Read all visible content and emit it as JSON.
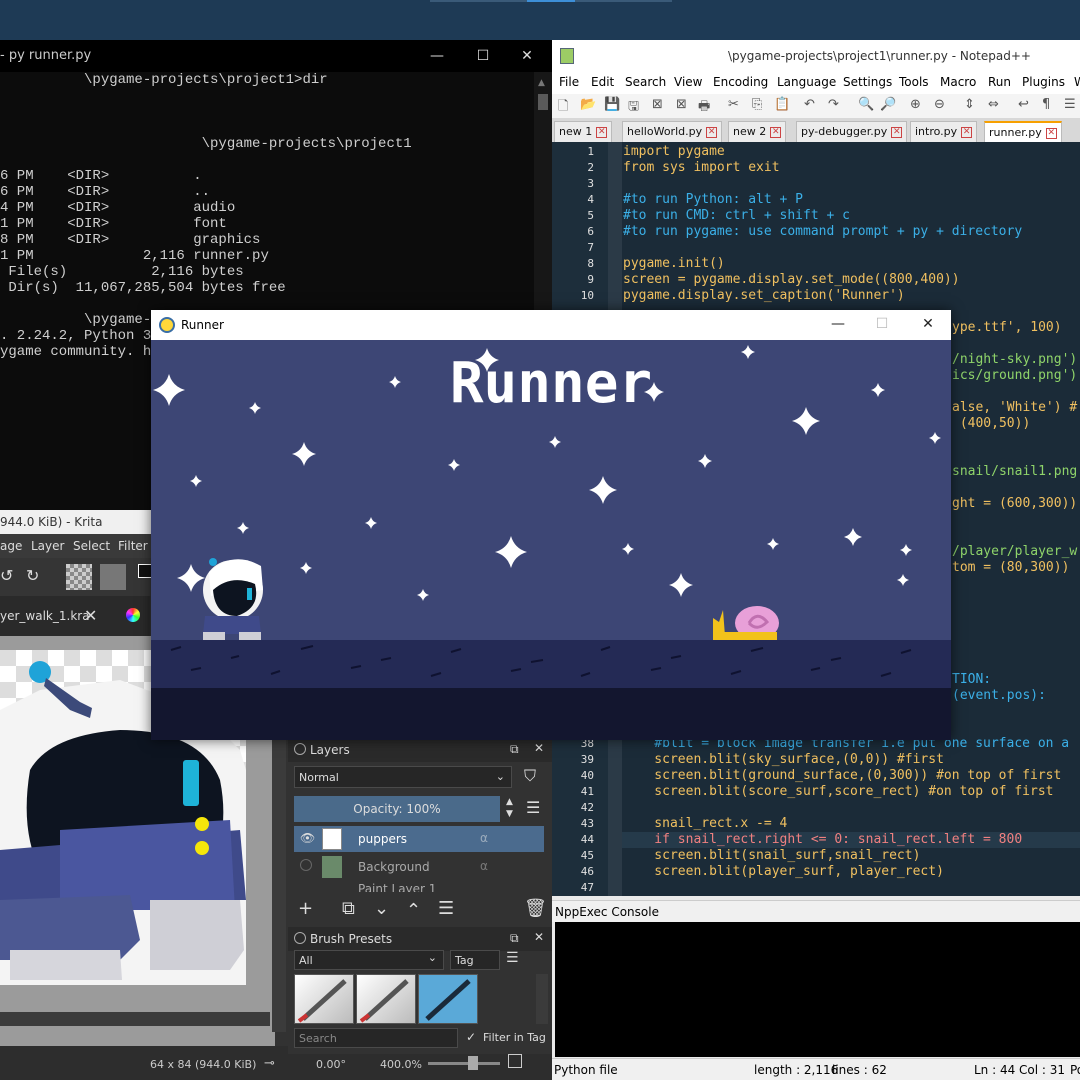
{
  "terminal": {
    "title": "- py  runner.py",
    "lines": [
      "          \\pygame-projects\\project1>dir",
      "                        \\pygame-projects\\project1",
      "6 PM    <DIR>          .",
      "6 PM    <DIR>          ..",
      "4 PM    <DIR>          audio",
      "1 PM    <DIR>          font",
      "8 PM    <DIR>          graphics",
      "1 PM             2,116 runner.py",
      " File(s)          2,116 bytes",
      " Dir(s)  11,067,285,504 bytes free",
      "          \\pygame-p",
      ". 2.24.2, Python 3.",
      "ygame community. ht"
    ]
  },
  "krita": {
    "title": "944.0 KiB)  - Krita",
    "menu": [
      "age",
      "Layer",
      "Select",
      "Filter"
    ],
    "doc_tab": "yer_walk_1.kra",
    "status": {
      "size": "64 x 84 (944.0 KiB)",
      "rotation": "0.00°",
      "zoom": "400.0%"
    },
    "layers_panel": {
      "title": "Layers",
      "blend_mode": "Normal",
      "opacity": "Opacity:  100%",
      "layers": [
        "puppers",
        "Background",
        "Paint Layer 1"
      ]
    },
    "brush_panel": {
      "title": "Brush Presets",
      "filter_value": "All",
      "tag_label": "Tag",
      "search_placeholder": "Search",
      "filter_in_tag": "Filter in Tag"
    }
  },
  "notepadpp": {
    "title": "\\pygame-projects\\project1\\runner.py - Notepad++",
    "menu": [
      "File",
      "Edit",
      "Search",
      "View",
      "Encoding",
      "Language",
      "Settings",
      "Tools",
      "Macro",
      "Run",
      "Plugins",
      "W"
    ],
    "tabs": [
      "new 1",
      "helloWorld.py",
      "new 2",
      "py-debugger.py",
      "intro.py",
      "runner.py"
    ],
    "active_tab": "runner.py",
    "code_top": [
      {
        "n": "1",
        "t": "import pygame"
      },
      {
        "n": "2",
        "t": "from sys import exit"
      },
      {
        "n": "3",
        "t": ""
      },
      {
        "n": "4",
        "t": "#to run Python: alt + P"
      },
      {
        "n": "5",
        "t": "#to run CMD: ctrl + shift + c"
      },
      {
        "n": "6",
        "t": "#to run pygame: use command prompt + py + directory"
      },
      {
        "n": "7",
        "t": ""
      },
      {
        "n": "8",
        "t": "pygame.init()"
      },
      {
        "n": "9",
        "t": "screen = pygame.display.set_mode((800,400))"
      },
      {
        "n": "10",
        "t": "pygame.display.set_caption('Runner')"
      }
    ],
    "code_right_fragments": [
      "ype.ttf', 100)",
      "/night-sky.png')",
      "ics/ground.png')",
      "alse, 'White') #",
      " (400,50))",
      "snail/snail1.png",
      "ght = (600,300))",
      "/player/player_w",
      "tom = (80,300))",
      "TION:",
      "(event.pos):"
    ],
    "code_bottom": [
      {
        "n": "38",
        "t": "    #blit = block image transfer i.e put one surface on a"
      },
      {
        "n": "39",
        "t": "    screen.blit(sky_surface,(0,0)) #first"
      },
      {
        "n": "40",
        "t": "    screen.blit(ground_surface,(0,300)) #on top of first"
      },
      {
        "n": "41",
        "t": "    screen.blit(score_surf,score_rect) #on top of first"
      },
      {
        "n": "42",
        "t": ""
      },
      {
        "n": "43",
        "t": "    snail_rect.x -= 4"
      },
      {
        "n": "44",
        "t": "    if snail_rect.right <= 0: snail_rect.left = 800"
      },
      {
        "n": "45",
        "t": "    screen.blit(snail_surf,snail_rect)"
      },
      {
        "n": "46",
        "t": "    screen.blit(player_surf, player_rect)"
      },
      {
        "n": "47",
        "t": ""
      }
    ],
    "console_title": "NppExec Console",
    "status": {
      "type": "Python file",
      "length": "length : 2,116",
      "lines": "lines : 62",
      "pos": "Ln : 44    Col : 31",
      "extra": "Po"
    }
  },
  "runner": {
    "title": "Runner",
    "game_title": "Runner",
    "colors": {
      "sky": "#3d4675",
      "ground": "#242a55",
      "ground_dark": "#13162f"
    }
  }
}
